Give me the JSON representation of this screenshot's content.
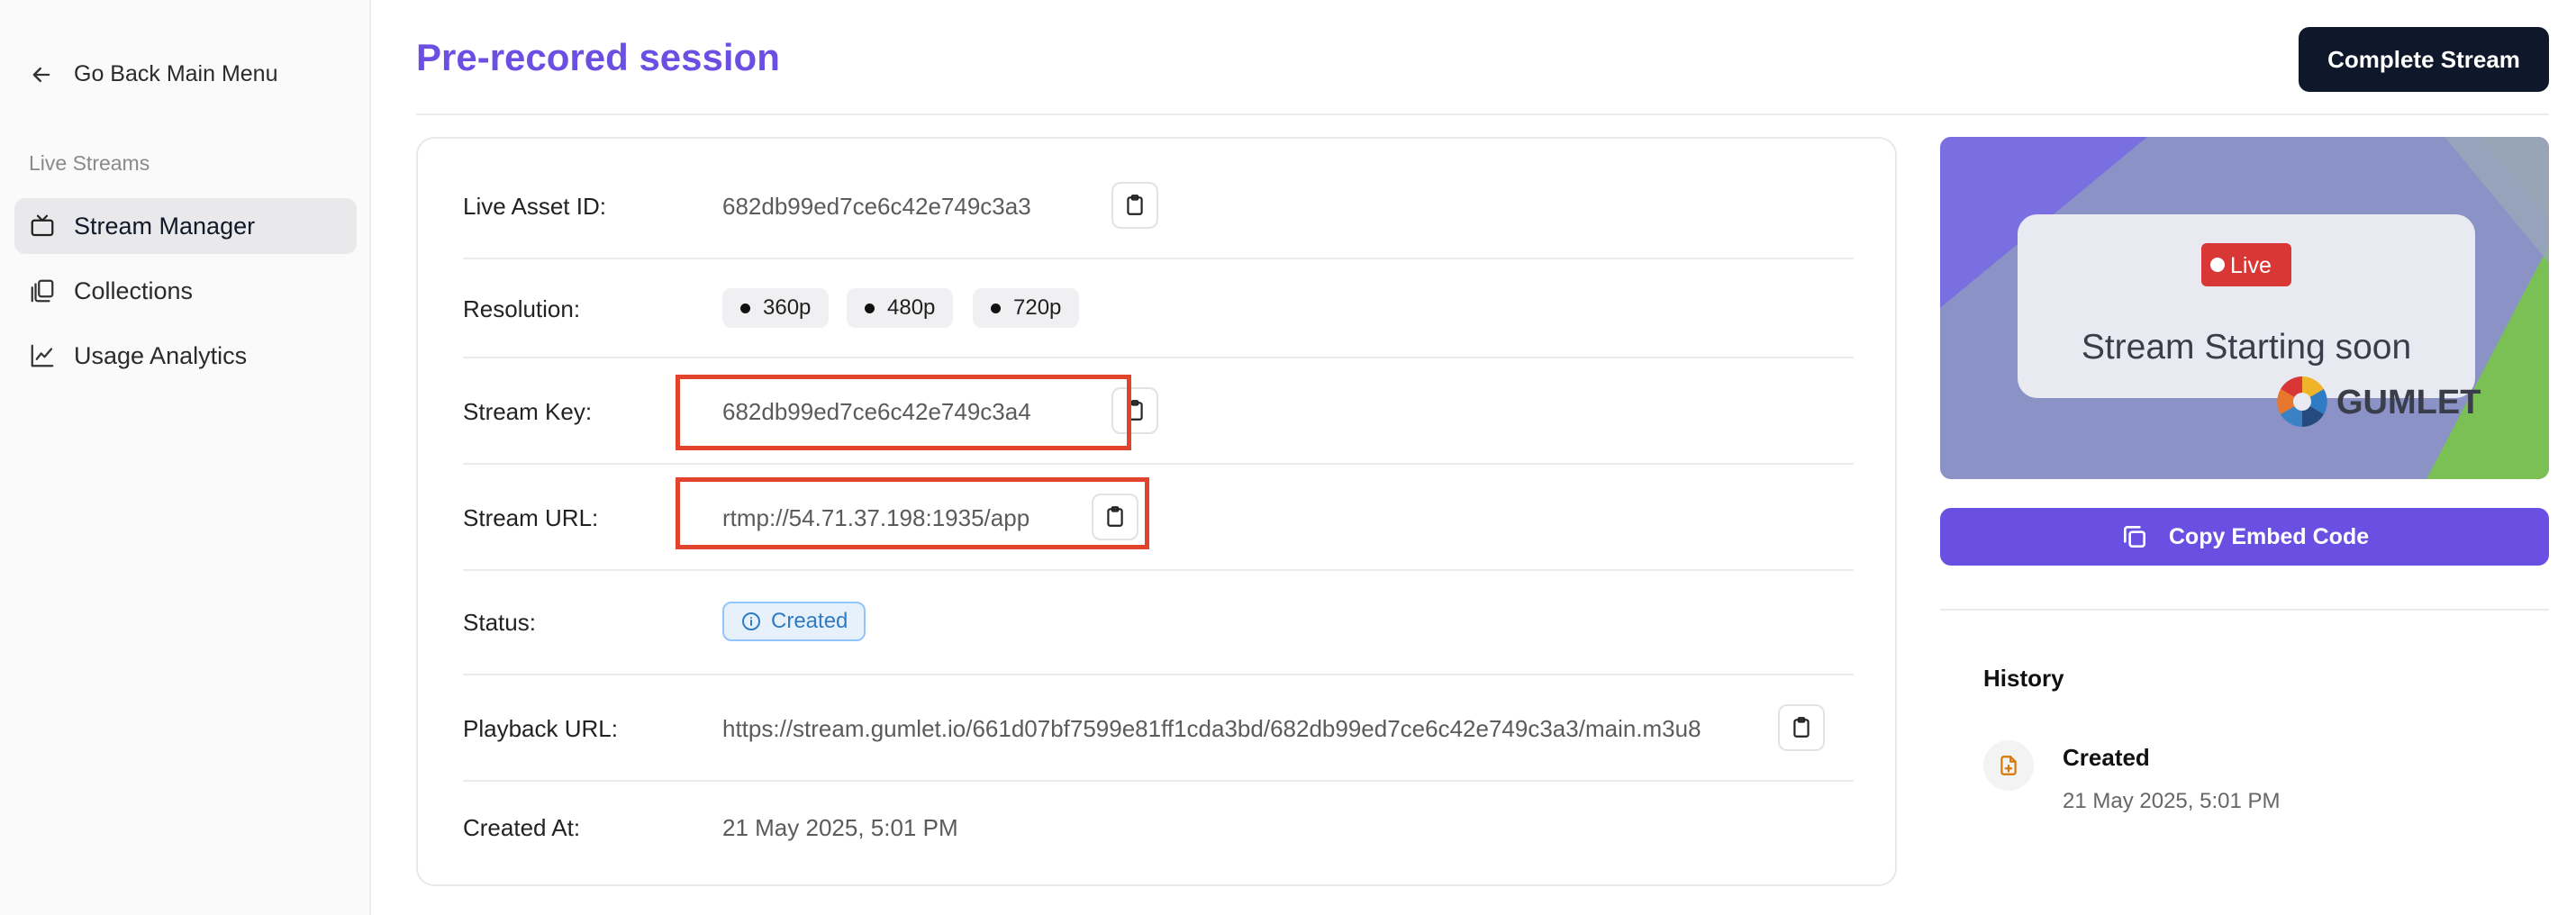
{
  "sidebar": {
    "back_label": "Go Back Main Menu",
    "section_label": "Live Streams",
    "items": [
      {
        "label": "Stream Manager",
        "icon": "tv-icon",
        "active": true
      },
      {
        "label": "Collections",
        "icon": "collections-icon",
        "active": false
      },
      {
        "label": "Usage Analytics",
        "icon": "chart-line-icon",
        "active": false
      }
    ]
  },
  "header": {
    "title": "Pre-recored session",
    "complete_button": "Complete Stream"
  },
  "details": {
    "live_asset_id": {
      "label": "Live Asset ID:",
      "value": "682db99ed7ce6c42e749c3a3"
    },
    "resolution": {
      "label": "Resolution:",
      "options": [
        "360p",
        "480p",
        "720p"
      ]
    },
    "stream_key": {
      "label": "Stream Key:",
      "value": "682db99ed7ce6c42e749c3a4"
    },
    "stream_url": {
      "label": "Stream URL:",
      "value": "rtmp://54.71.37.198:1935/app"
    },
    "status": {
      "label": "Status:",
      "value": "Created"
    },
    "playback_url": {
      "label": "Playback URL:",
      "value": "https://stream.gumlet.io/661d07bf7599e81ff1cda3bd/682db99ed7ce6c42e749c3a3/main.m3u8"
    },
    "created_at": {
      "label": "Created At:",
      "value": "21 May 2025, 5:01 PM"
    }
  },
  "preview": {
    "live_badge": "Live",
    "message": "Stream Starting soon",
    "logo_text": "GUMLET"
  },
  "embed_button": "Copy Embed Code",
  "history": {
    "title": "History",
    "items": [
      {
        "label": "Created",
        "date": "21 May 2025, 5:01 PM"
      }
    ]
  },
  "colors": {
    "accent": "#6a4fe3",
    "title": "#6b4fe3",
    "dark_button": "#0f172a",
    "highlight": "#e2432d",
    "status": "#2f7bc4"
  }
}
